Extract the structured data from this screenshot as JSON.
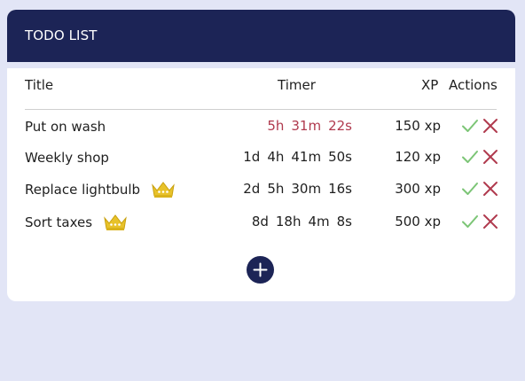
{
  "header": {
    "title": "TODO LIST"
  },
  "table": {
    "columns": {
      "title": "Title",
      "timer": "Timer",
      "xp": "XP",
      "actions": "Actions"
    },
    "rows": [
      {
        "title": "Put on wash",
        "crown": false,
        "timer": [
          "5h",
          "31m",
          "22s"
        ],
        "urgent": true,
        "xp": "150 xp"
      },
      {
        "title": "Weekly shop",
        "crown": false,
        "timer": [
          "1d",
          "4h",
          "41m",
          "50s"
        ],
        "urgent": false,
        "xp": "120 xp"
      },
      {
        "title": "Replace lightbulb",
        "crown": true,
        "timer": [
          "2d",
          "5h",
          "30m",
          "16s"
        ],
        "urgent": false,
        "xp": "300 xp"
      },
      {
        "title": "Sort taxes",
        "crown": true,
        "timer": [
          "8d",
          "18h",
          "4m",
          "8s"
        ],
        "urgent": false,
        "xp": "500 xp"
      }
    ]
  },
  "icons": {
    "complete": "check-icon",
    "delete": "close-icon",
    "priority": "crown-icon",
    "add": "plus-icon"
  },
  "colors": {
    "header_bg": "#1c2456",
    "page_bg": "#e2e5f6",
    "urgent_timer": "#b03a4e",
    "check": "#7cc576",
    "cross": "#b03a4e",
    "crown": "#e8c22a"
  }
}
